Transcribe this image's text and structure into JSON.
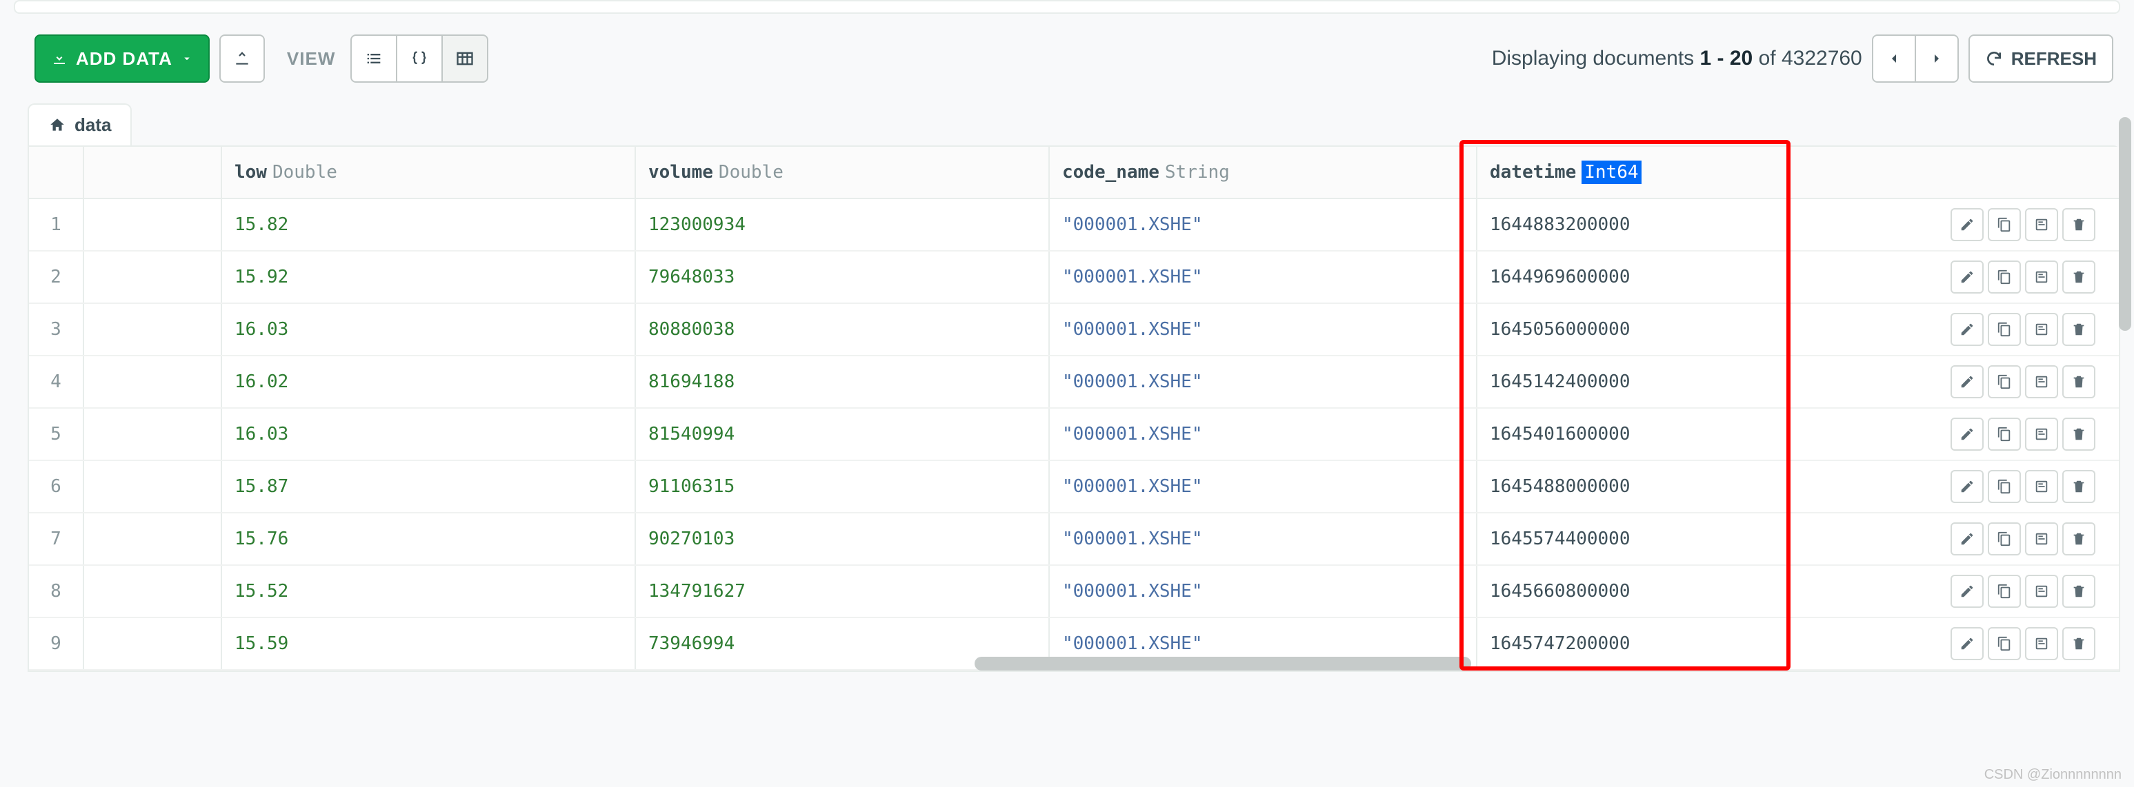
{
  "toolbar": {
    "add_data_label": "ADD DATA",
    "view_label": "VIEW",
    "refresh_label": "REFRESH"
  },
  "doc_count": {
    "prefix": "Displaying documents ",
    "range": "1 - 20",
    "middle": " of ",
    "total": "4322760"
  },
  "tab": {
    "label": "data"
  },
  "columns": {
    "low": {
      "name": "low",
      "type": "Double"
    },
    "volume": {
      "name": "volume",
      "type": "Double"
    },
    "code_name": {
      "name": "code_name",
      "type": "String"
    },
    "datetime": {
      "name": "datetime",
      "type": "Int64"
    }
  },
  "rows": [
    {
      "idx": "1",
      "low": "15.82",
      "volume": "123000934",
      "code_name": "\"000001.XSHE\"",
      "datetime": "1644883200000"
    },
    {
      "idx": "2",
      "low": "15.92",
      "volume": "79648033",
      "code_name": "\"000001.XSHE\"",
      "datetime": "1644969600000"
    },
    {
      "idx": "3",
      "low": "16.03",
      "volume": "80880038",
      "code_name": "\"000001.XSHE\"",
      "datetime": "1645056000000"
    },
    {
      "idx": "4",
      "low": "16.02",
      "volume": "81694188",
      "code_name": "\"000001.XSHE\"",
      "datetime": "1645142400000"
    },
    {
      "idx": "5",
      "low": "16.03",
      "volume": "81540994",
      "code_name": "\"000001.XSHE\"",
      "datetime": "1645401600000"
    },
    {
      "idx": "6",
      "low": "15.87",
      "volume": "91106315",
      "code_name": "\"000001.XSHE\"",
      "datetime": "1645488000000"
    },
    {
      "idx": "7",
      "low": "15.76",
      "volume": "90270103",
      "code_name": "\"000001.XSHE\"",
      "datetime": "1645574400000"
    },
    {
      "idx": "8",
      "low": "15.52",
      "volume": "134791627",
      "code_name": "\"000001.XSHE\"",
      "datetime": "1645660800000"
    },
    {
      "idx": "9",
      "low": "15.59",
      "volume": "73946994",
      "code_name": "\"000001.XSHE\"",
      "datetime": "1645747200000"
    }
  ],
  "watermark": "CSDN @Zionnnnnnnn"
}
